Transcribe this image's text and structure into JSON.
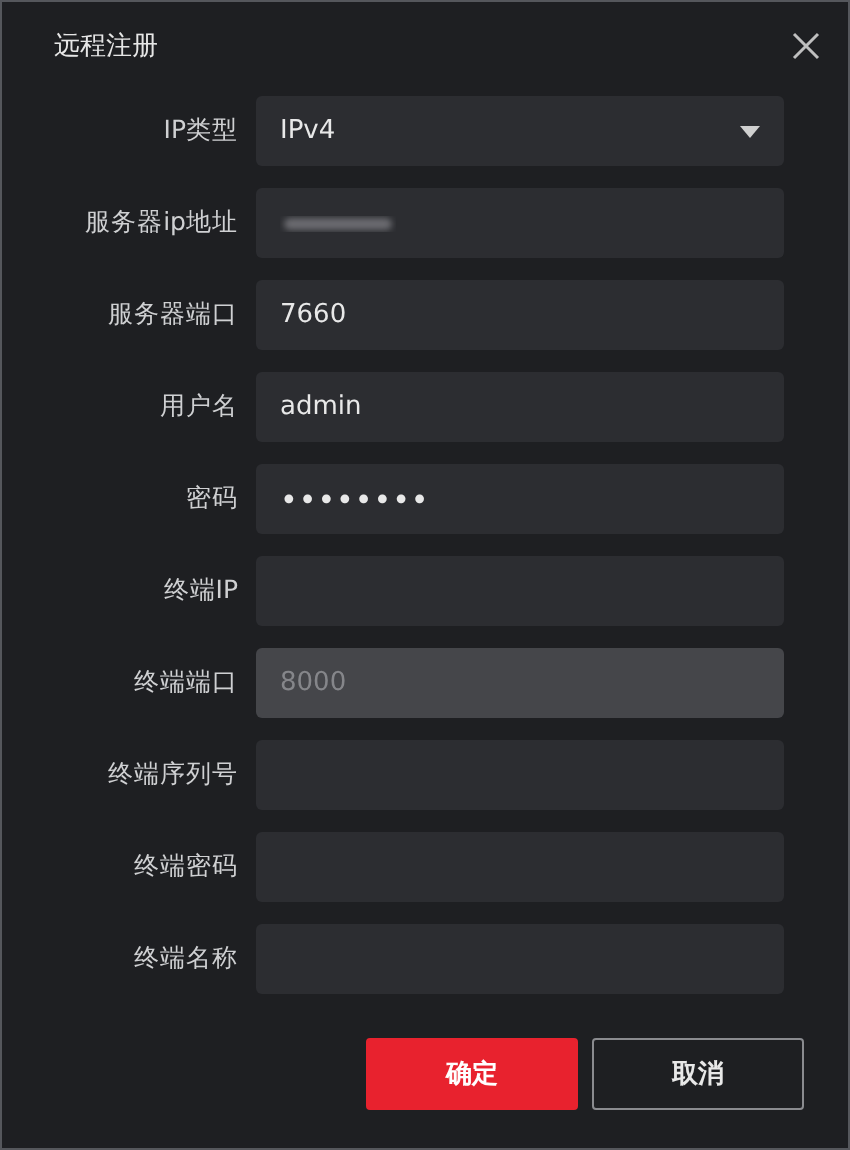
{
  "dialog": {
    "title": "远程注册"
  },
  "fields": [
    {
      "label": "IP类型",
      "kind": "select",
      "value": "IPv4",
      "disabled": false
    },
    {
      "label": "服务器ip地址",
      "kind": "redacted",
      "disabled": false
    },
    {
      "label": "服务器端口",
      "kind": "text",
      "value": "7660",
      "disabled": false
    },
    {
      "label": "用户名",
      "kind": "text",
      "value": "admin",
      "disabled": false
    },
    {
      "label": "密码",
      "kind": "password",
      "value": "••••••••",
      "disabled": false
    },
    {
      "label": "终端IP",
      "kind": "text",
      "disabled": false
    },
    {
      "label": "终端端口",
      "kind": "text",
      "value": "8000",
      "disabled": true
    },
    {
      "label": "终端序列号",
      "kind": "text",
      "disabled": false
    },
    {
      "label": "终端密码",
      "kind": "text",
      "disabled": false
    },
    {
      "label": "终端名称",
      "kind": "text",
      "disabled": false
    }
  ],
  "buttons": [
    {
      "label": "确定",
      "kind": "primary"
    },
    {
      "label": "取消",
      "kind": "secondary"
    }
  ]
}
